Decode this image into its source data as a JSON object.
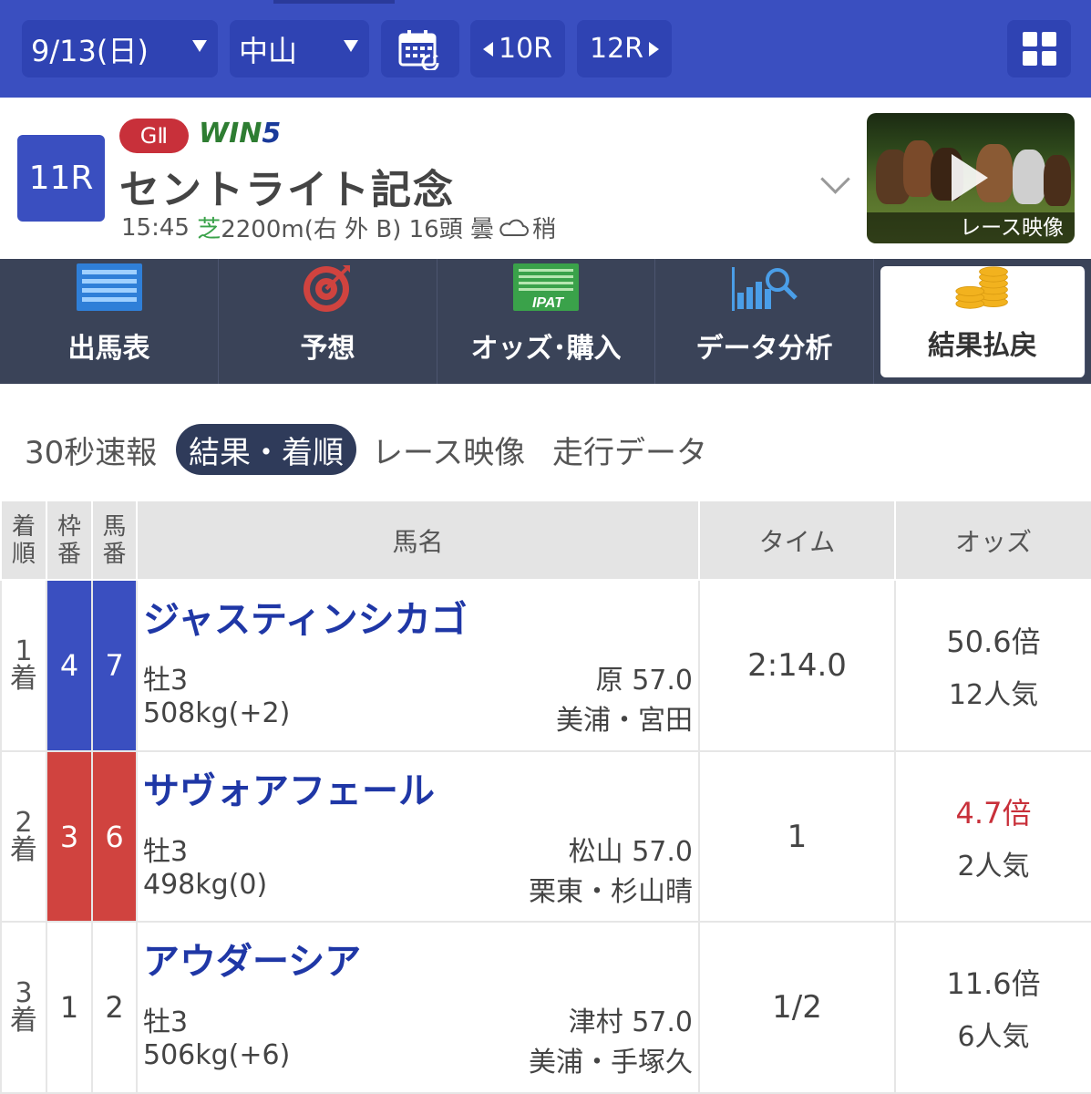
{
  "nav": {
    "date": "9/13(日)",
    "venue": "中山",
    "prev_race": "10R",
    "next_race": "12R",
    "icons": [
      "calendar-icon",
      "grid-menu-icon"
    ]
  },
  "race": {
    "number": "11R",
    "grade": "GⅡ",
    "win5_prefix": "WIN",
    "win5_suffix": "5",
    "name": "セントライト記念",
    "time": "15:45",
    "surface": "芝",
    "course": "2200m(右 外 B)",
    "runners": "16頭",
    "weather": "曇",
    "going": "稍",
    "video_label": "レース映像"
  },
  "tabs": [
    {
      "label": "出馬表",
      "icon": "entry-table-icon"
    },
    {
      "label": "予想",
      "icon": "target-icon"
    },
    {
      "label": "オッズ･購入",
      "icon": "ipat-icon"
    },
    {
      "label": "データ分析",
      "icon": "data-analysis-icon"
    },
    {
      "label": "結果払戻",
      "icon": "coins-icon",
      "active": true
    }
  ],
  "ipat_text": "IPAT",
  "subtabs": [
    {
      "label": "30秒速報"
    },
    {
      "label": "結果・着順",
      "active": true
    },
    {
      "label": "レース映像"
    },
    {
      "label": "走行データ"
    }
  ],
  "table": {
    "headers": {
      "rank_1": "着",
      "rank_2": "順",
      "waku_1": "枠",
      "waku_2": "番",
      "uma_1": "馬",
      "uma_2": "番",
      "name": "馬名",
      "time": "タイム",
      "odds": "オッズ"
    },
    "rows": [
      {
        "rank_1": "1",
        "rank_2": "着",
        "waku": "4",
        "umaban": "7",
        "horse": "ジャスティンシカゴ",
        "sex_age": "牡3",
        "weight": "508kg(+2)",
        "jockey": "原 57.0",
        "trainer": "美浦・宮田",
        "time": "2:14.0",
        "odds": "50.6倍",
        "popularity": "12人気",
        "waku_color": "#3a4fc0"
      },
      {
        "rank_1": "2",
        "rank_2": "着",
        "waku": "3",
        "umaban": "6",
        "horse": "サヴォアフェール",
        "sex_age": "牡3",
        "weight": "498kg(0)",
        "jockey": "松山 57.0",
        "trainer": "栗東・杉山晴",
        "time": "1",
        "odds": "4.7倍",
        "popularity": "2人気",
        "waku_color": "#d0433f"
      },
      {
        "rank_1": "3",
        "rank_2": "着",
        "waku": "1",
        "umaban": "2",
        "horse": "アウダーシア",
        "sex_age": "牡3",
        "weight": "506kg(+6)",
        "jockey": "津村 57.0",
        "trainer": "美浦・手塚久",
        "time": "1/2",
        "odds": "11.6倍",
        "popularity": "6人気",
        "waku_color": "#ffffff"
      }
    ]
  },
  "colors": {
    "nav_bg": "#3a4fc0",
    "tab_bg": "#3a4358",
    "horse_name": "#1f37a6",
    "grade_red": "#c8303a",
    "favorite_odds": "#c8303a"
  }
}
